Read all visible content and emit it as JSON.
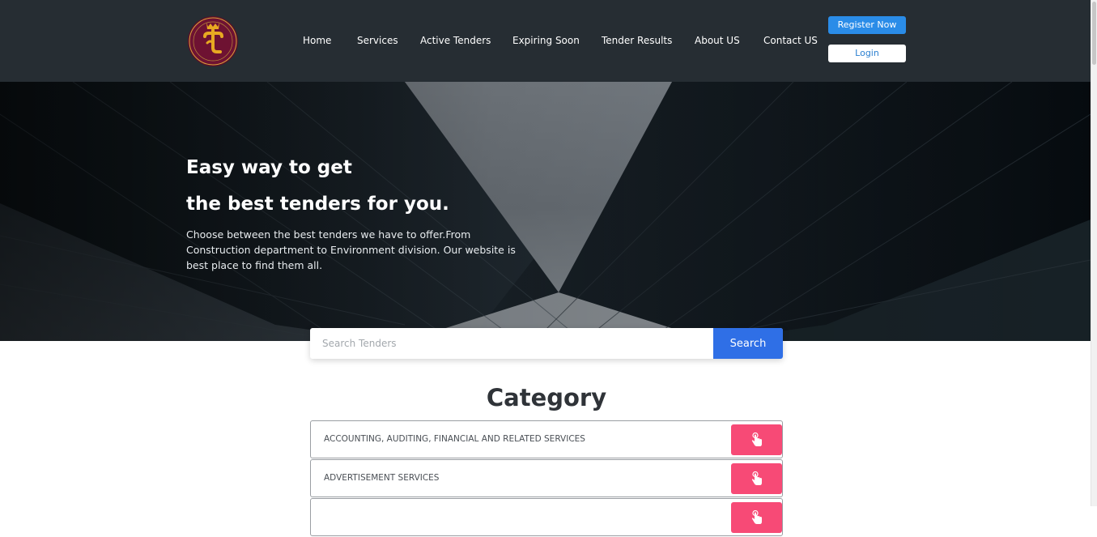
{
  "header": {
    "logo_icon": "crowned-t-logo",
    "nav": [
      {
        "label": "Home"
      },
      {
        "label": "Services"
      },
      {
        "label": "Active Tenders"
      },
      {
        "label": "Expiring Soon"
      },
      {
        "label": "Tender Results"
      },
      {
        "label": "About US"
      },
      {
        "label": "Contact US"
      }
    ],
    "register_label": "Register Now",
    "login_label": "Login"
  },
  "hero": {
    "title_line1": "Easy way to get",
    "title_line2": "the best tenders for you.",
    "description": "Choose between the best tenders we have to offer.From Construction department to Environment division. Our website is best place to find them all."
  },
  "search": {
    "placeholder": "Search Tenders",
    "value": "",
    "button_label": "Search"
  },
  "category": {
    "title": "Category",
    "items": [
      {
        "label": "ACCOUNTING, AUDITING, FINANCIAL AND RELATED SERVICES",
        "icon": "tap-hand-icon"
      },
      {
        "label": "ADVERTISEMENT SERVICES",
        "icon": "tap-hand-icon"
      },
      {
        "label": "",
        "icon": "tap-hand-icon"
      }
    ]
  },
  "colors": {
    "header_bg": "#262d33",
    "register_btn": "#2a8ce8",
    "search_btn": "#2f6fe6",
    "category_btn": "#f74a76",
    "logo_gold": "#e8a922",
    "logo_maroon": "#6e1232"
  }
}
